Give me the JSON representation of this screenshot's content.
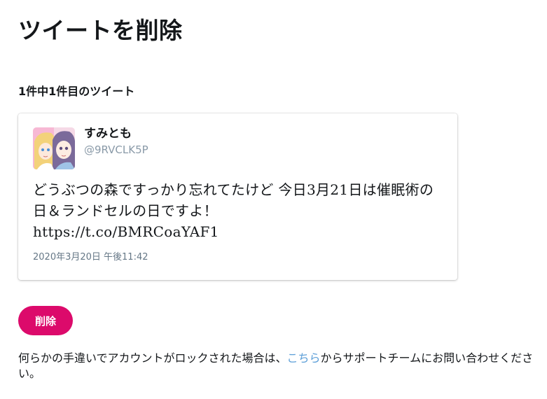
{
  "page": {
    "title": "ツイートを削除",
    "subtitle": "1件中1件目のツイート"
  },
  "tweet": {
    "display_name": "すみとも",
    "handle": "@9RVCLK5P",
    "text": "どうぶつの森ですっかり忘れてたけど 今日3月21日は催眠術の日＆ランドセルの日ですよ！\nhttps://t.co/BMRCoaYAF1",
    "timestamp": "2020年3月20日 午後11:42",
    "avatar_icon": "anime-characters-avatar"
  },
  "actions": {
    "delete_label": "削除"
  },
  "help": {
    "prefix": "何らかの手違いでアカウントがロックされた場合は、",
    "link_text": "こちら",
    "suffix": "からサポートチームにお問い合わせください。"
  },
  "colors": {
    "accent": "#dc0a6b",
    "link": "#5d9fd8",
    "handle": "#8a9aa8",
    "text": "#14171a"
  }
}
